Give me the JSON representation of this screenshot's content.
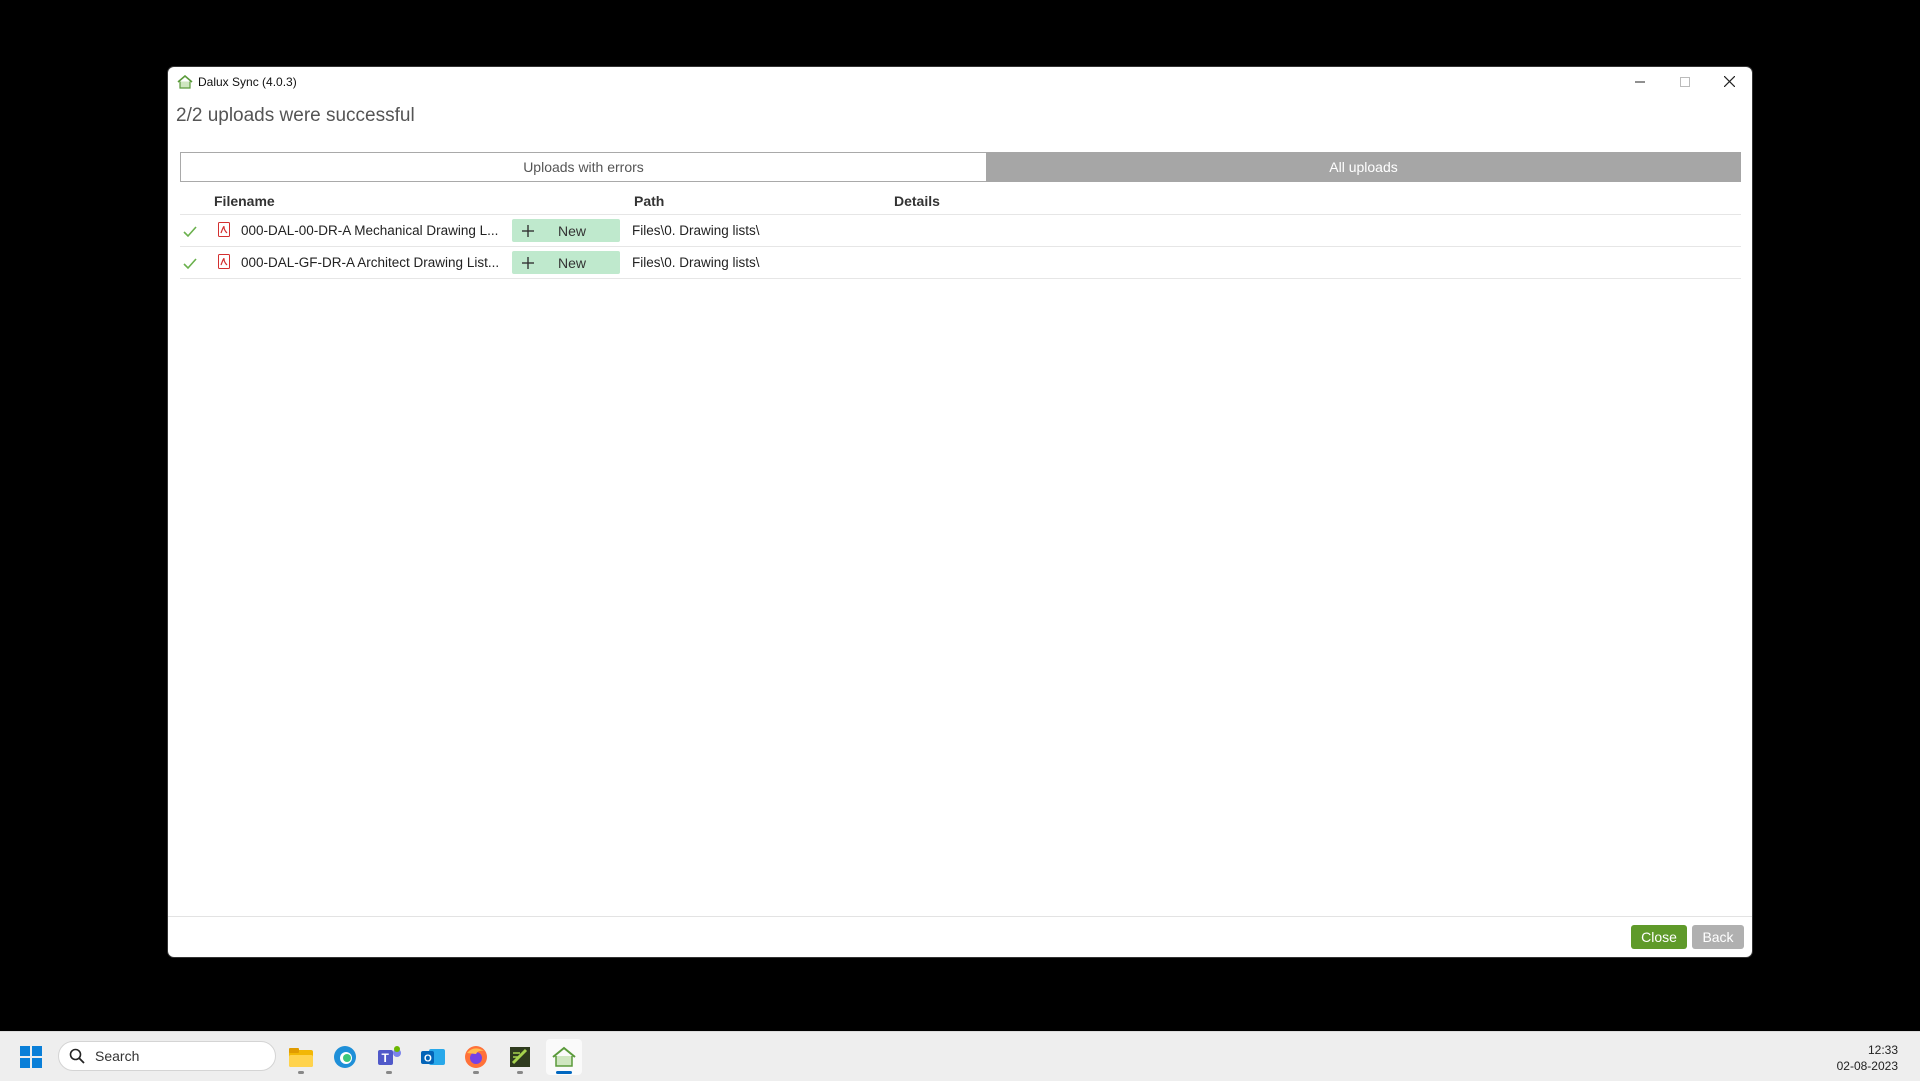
{
  "window": {
    "title": "Dalux Sync (4.0.3)",
    "heading": "2/2 uploads were successful"
  },
  "tabs": [
    {
      "label": "Uploads with errors",
      "active": false
    },
    {
      "label": "All uploads",
      "active": true
    }
  ],
  "table": {
    "headers": {
      "filename": "Filename",
      "path": "Path",
      "details": "Details"
    },
    "rows": [
      {
        "status_ok": true,
        "filename": "000-DAL-00-DR-A Mechanical Drawing L...",
        "change": "New",
        "path": "Files\\0. Drawing lists\\",
        "details": ""
      },
      {
        "status_ok": true,
        "filename": "000-DAL-GF-DR-A Architect Drawing List...",
        "change": "New",
        "path": "Files\\0. Drawing lists\\",
        "details": ""
      }
    ]
  },
  "footer": {
    "close_label": "Close",
    "back_label": "Back"
  },
  "taskbar": {
    "search_placeholder": "Search",
    "apps": [
      "file-explorer-icon",
      "edge-icon",
      "teams-icon",
      "outlook-icon",
      "firefox-icon",
      "notepadpp-icon",
      "dalux-sync-icon"
    ],
    "time": "12:33",
    "date": "02-08-2023"
  },
  "colors": {
    "accent_green": "#5f9a2a",
    "new_badge": "#bfe9cd",
    "check_green": "#6ab04c",
    "tab_active": "#a6a6a6"
  }
}
